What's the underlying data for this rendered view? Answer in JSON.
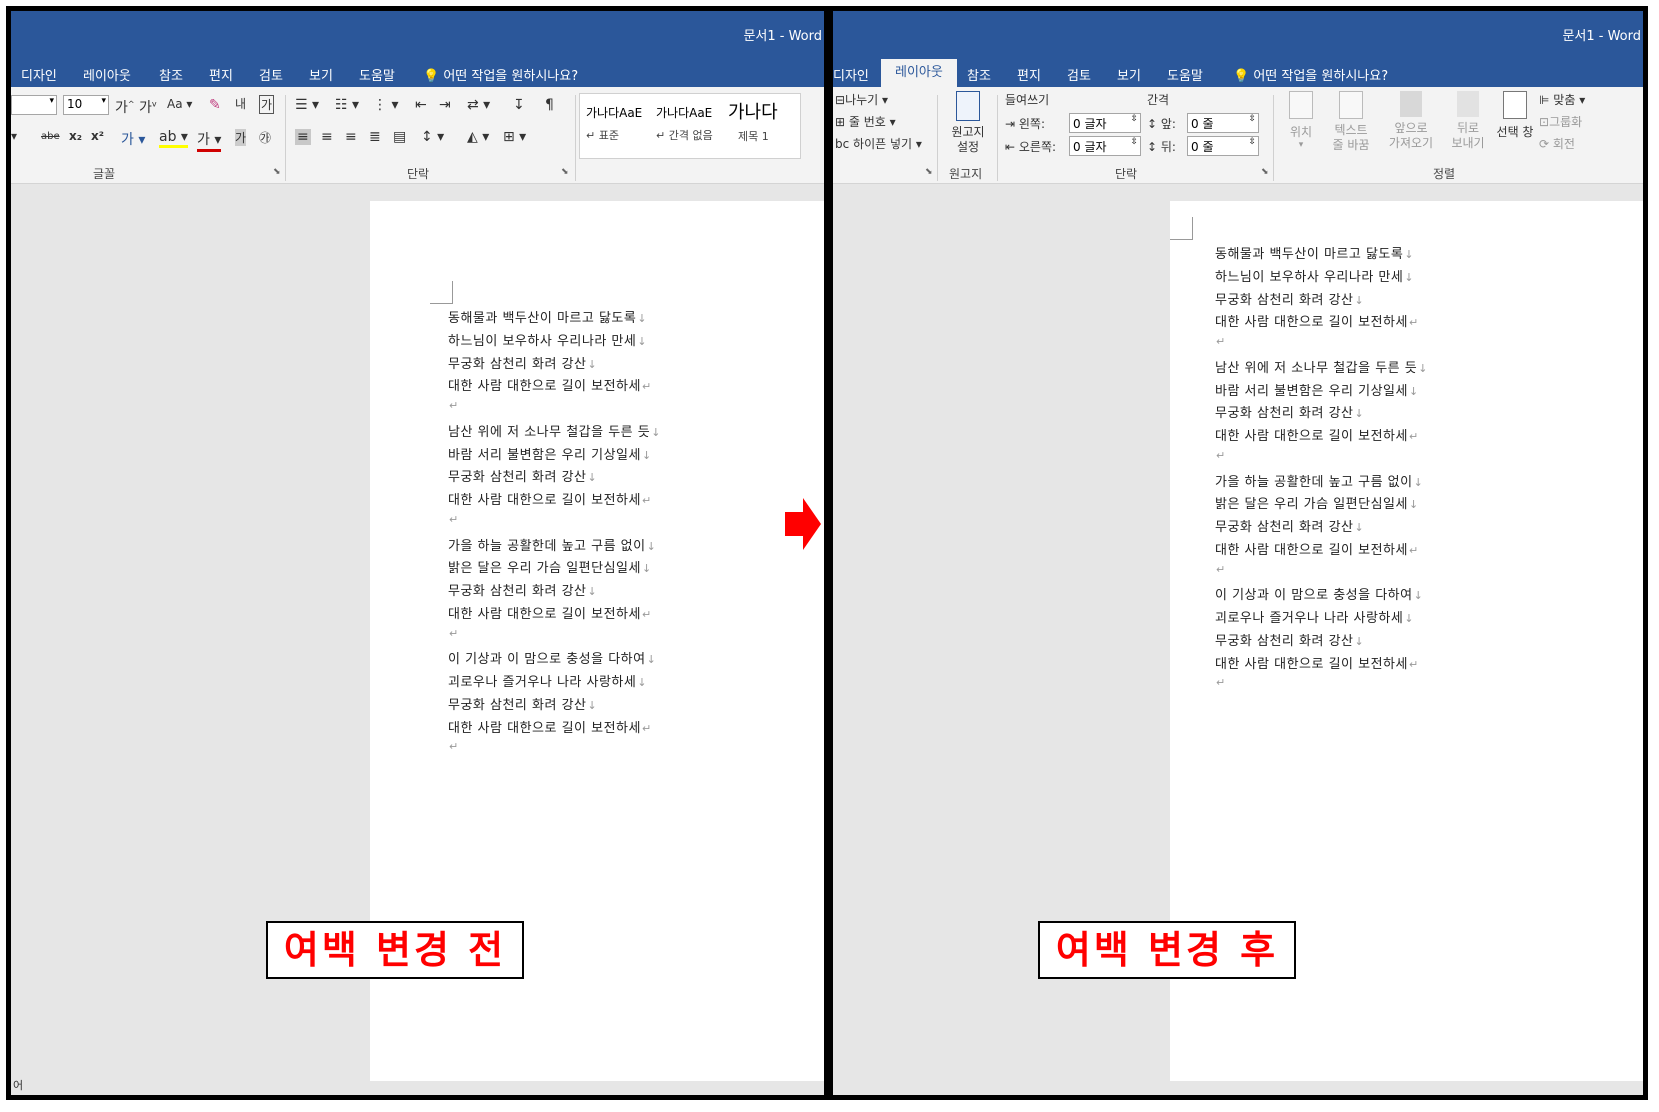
{
  "window": {
    "title": "문서1  -  Word"
  },
  "left_tabs": [
    "디자인",
    "레이아웃",
    "참조",
    "편지",
    "검토",
    "보기",
    "도움말"
  ],
  "right_tabs": [
    "디자인",
    "레이아웃",
    "참조",
    "편지",
    "검토",
    "보기",
    "도움말"
  ],
  "tell_me": "어떤 작업을 원하시나요?",
  "left_ribbon": {
    "font_size": "10",
    "font_group": "글꼴",
    "paragraph_group": "단락",
    "styles": [
      {
        "preview": "가나다AaE",
        "name": "↵ 표준"
      },
      {
        "preview": "가나다AaE",
        "name": "↵ 간격 없음"
      },
      {
        "preview": "가나다",
        "name": "제목 1"
      }
    ]
  },
  "right_ribbon": {
    "breaks": "나누기",
    "line_numbers": "줄 번호",
    "hyphenation": "하이픈 넣기",
    "manuscript_btn_l1": "원고지",
    "manuscript_btn_l2": "설정",
    "manuscript_group": "원고지",
    "indent_label": "들여쓰기",
    "spacing_label": "간격",
    "left_label": "왼쪽:",
    "right_label": "오른쪽:",
    "before_label": "앞:",
    "after_label": "뒤:",
    "left_value": "0 글자",
    "right_value": "0 글자",
    "before_value": "0 줄",
    "after_value": "0 줄",
    "paragraph_group": "단락",
    "arrange_group": "정렬",
    "position": "위치",
    "wrap_l1": "텍스트",
    "wrap_l2": "줄 바꿈",
    "forward_l1": "앞으로",
    "forward_l2": "가져오기",
    "backward_l1": "뒤로",
    "backward_l2": "보내기",
    "select_pane": "선택 창",
    "align": "맞춤",
    "group": "그룹화",
    "rotate": "회전"
  },
  "lyrics": [
    [
      "동해물과 백두산이 마르고 닳도록",
      "하느님이 보우하사 우리나라 만세",
      "무궁화 삼천리 화려 강산",
      "대한 사람 대한으로 길이 보전하세"
    ],
    [
      "남산 위에 저 소나무 철갑을 두른 듯",
      "바람 서리 불변함은 우리 기상일세",
      "무궁화 삼천리 화려 강산",
      "대한 사람 대한으로 길이 보전하세"
    ],
    [
      "가을 하늘 공활한데 높고 구름 없이",
      "밝은 달은 우리 가슴 일편단심일세",
      "무궁화 삼천리 화려 강산",
      "대한 사람 대한으로 길이 보전하세"
    ],
    [
      "이 기상과 이 맘으로 충성을 다하여",
      "괴로우나 즐거우나 나라 사랑하세",
      "무궁화 삼천리 화려 강산",
      "대한 사람 대한으로 길이 보전하세"
    ]
  ],
  "captions": {
    "before": "여백 변경 전",
    "after": "여백 변경 후"
  },
  "status_left": "어",
  "colors": {
    "ribbon_blue": "#2b579a",
    "caption_red": "#ff0000",
    "arrow_red": "#ff0000"
  }
}
